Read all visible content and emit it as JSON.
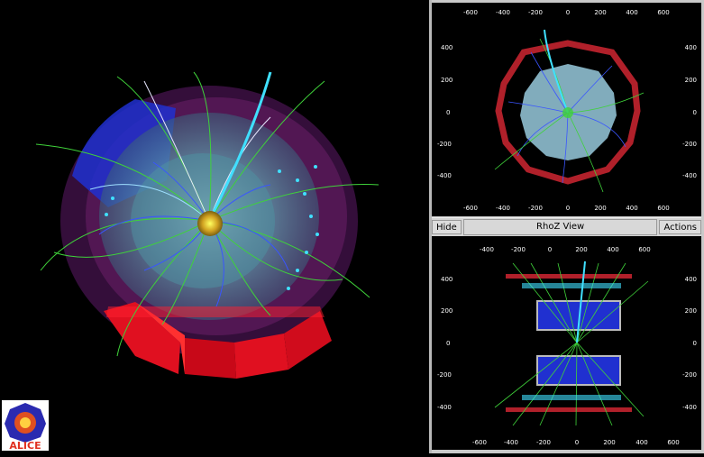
{
  "views": {
    "rphi": {
      "x_ticks": [
        "-600",
        "-400",
        "-200",
        "0",
        "200",
        "400",
        "600"
      ],
      "y_ticks": [
        "400",
        "200",
        "0",
        "-200",
        "-400"
      ]
    },
    "rhoz": {
      "title": "RhoZ View",
      "hide_label": "Hide",
      "actions_label": "Actions",
      "x_ticks": [
        "-600",
        "-400",
        "-200",
        "0",
        "200",
        "400",
        "600"
      ],
      "y_ticks": [
        "400",
        "200",
        "0",
        "-200",
        "-400"
      ]
    }
  },
  "logo": {
    "text": "ALICE"
  },
  "colors": {
    "background": "#000000",
    "tracks_green": "#3fd23a",
    "tracks_blue": "#3a55ff",
    "tracks_cyan": "#40e0ff",
    "calorimeter_red": "#e0101a",
    "tpc_cyan": "#5fa0b0",
    "frame_gray": "#c9c9c9"
  }
}
